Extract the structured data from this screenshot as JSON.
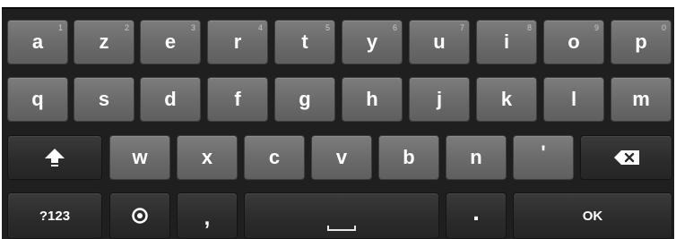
{
  "keyboard": {
    "row1": [
      {
        "label": "a",
        "hint": "1"
      },
      {
        "label": "z",
        "hint": "2"
      },
      {
        "label": "e",
        "hint": "3"
      },
      {
        "label": "r",
        "hint": "4"
      },
      {
        "label": "t",
        "hint": "5"
      },
      {
        "label": "y",
        "hint": "6"
      },
      {
        "label": "u",
        "hint": "7"
      },
      {
        "label": "i",
        "hint": "8"
      },
      {
        "label": "o",
        "hint": "9"
      },
      {
        "label": "p",
        "hint": "0"
      }
    ],
    "row2": [
      {
        "label": "q"
      },
      {
        "label": "s"
      },
      {
        "label": "d"
      },
      {
        "label": "f"
      },
      {
        "label": "g"
      },
      {
        "label": "h"
      },
      {
        "label": "j"
      },
      {
        "label": "k"
      },
      {
        "label": "l"
      },
      {
        "label": "m"
      }
    ],
    "row3": [
      {
        "label": "w"
      },
      {
        "label": "x"
      },
      {
        "label": "c"
      },
      {
        "label": "v"
      },
      {
        "label": "b"
      },
      {
        "label": "n"
      },
      {
        "label": "'"
      }
    ],
    "symbols_label": "?123",
    "comma_label": ",",
    "period_label": ".",
    "ok_label": "OK",
    "icons": {
      "shift": "shift-icon",
      "backspace": "backspace-icon",
      "settings": "settings-icon",
      "space": "space-icon"
    },
    "colors": {
      "letter_key": "#6f6f6f",
      "function_key": "#2e2e2e",
      "background": "#1f1f1f",
      "text": "#ffffff"
    }
  }
}
